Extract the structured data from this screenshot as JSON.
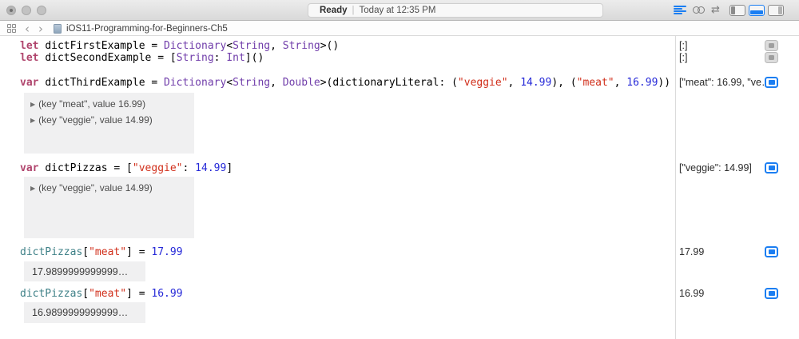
{
  "titlebar": {
    "status_ready": "Ready",
    "status_sep": "|",
    "status_time": "Today at 12:35 PM"
  },
  "jumpbar": {
    "file_name": "iOS11-Programming-for-Beginners-Ch5"
  },
  "colors": {
    "keyword": "#b0456d",
    "type": "#703daa",
    "string": "#d12f1b",
    "number": "#272ad8",
    "variable": "#3e8087",
    "accent": "#1b7ef2"
  },
  "editor": {
    "code_lines": [
      {
        "tokens": [
          [
            "kw",
            "let "
          ],
          [
            "pl",
            "dictFirstExample = "
          ],
          [
            "ty",
            "Dictionary"
          ],
          [
            "pl",
            "<"
          ],
          [
            "ty",
            "String"
          ],
          [
            "pl",
            ", "
          ],
          [
            "ty",
            "String"
          ],
          [
            "pl",
            ">()"
          ]
        ]
      },
      {
        "tokens": [
          [
            "kw",
            "let "
          ],
          [
            "pl",
            "dictSecondExample = ["
          ],
          [
            "ty",
            "String"
          ],
          [
            "pl",
            ": "
          ],
          [
            "ty",
            "Int"
          ],
          [
            "pl",
            "]()"
          ]
        ]
      },
      {
        "tokens": [
          [
            "kw",
            "var "
          ],
          [
            "pl",
            "dictThirdExample = "
          ],
          [
            "ty",
            "Dictionary"
          ],
          [
            "pl",
            "<"
          ],
          [
            "ty",
            "String"
          ],
          [
            "pl",
            ", "
          ],
          [
            "ty",
            "Double"
          ],
          [
            "pl",
            ">(dictionaryLiteral: ("
          ],
          [
            "st",
            "\"veggie\""
          ],
          [
            "pl",
            ", "
          ],
          [
            "nu",
            "14.99"
          ],
          [
            "pl",
            "), ("
          ],
          [
            "st",
            "\"meat\""
          ],
          [
            "pl",
            ", "
          ],
          [
            "nu",
            "16.99"
          ],
          [
            "pl",
            "))"
          ]
        ]
      },
      {
        "tokens": [
          [
            "kw",
            "var "
          ],
          [
            "pl",
            "dictPizzas = ["
          ],
          [
            "st",
            "\"veggie\""
          ],
          [
            "pl",
            ": "
          ],
          [
            "nu",
            "14.99"
          ],
          [
            "pl",
            "]"
          ]
        ]
      },
      {
        "tokens": [
          [
            "va",
            "dictPizzas"
          ],
          [
            "pl",
            "["
          ],
          [
            "st",
            "\"meat\""
          ],
          [
            "pl",
            "] = "
          ],
          [
            "nu",
            "17.99"
          ]
        ]
      },
      {
        "tokens": [
          [
            "va",
            "dictPizzas"
          ],
          [
            "pl",
            "["
          ],
          [
            "st",
            "\"meat\""
          ],
          [
            "pl",
            "] = "
          ],
          [
            "nu",
            "16.99"
          ]
        ]
      }
    ],
    "inline_results": [
      {
        "rows": [
          {
            "disclosure": true,
            "text": "(key \"meat\", value 16.99)"
          },
          {
            "disclosure": true,
            "text": "(key \"veggie\", value 14.99)"
          }
        ]
      },
      {
        "rows": [
          {
            "disclosure": true,
            "text": "(key \"veggie\", value 14.99)"
          }
        ]
      },
      {
        "rows": [
          {
            "disclosure": false,
            "text": "17.9899999999999…"
          }
        ]
      },
      {
        "rows": [
          {
            "disclosure": false,
            "text": "16.9899999999999…"
          }
        ]
      }
    ]
  },
  "sidebar": {
    "results": [
      {
        "text": "[:]",
        "button": "gray"
      },
      {
        "text": "[:]",
        "button": "gray"
      },
      {
        "text": "[\"meat\": 16.99, \"ve…",
        "button": "blue"
      },
      {
        "text": "[\"veggie\": 14.99]",
        "button": "blue"
      },
      {
        "text": "17.99",
        "button": "blue"
      },
      {
        "text": "16.99",
        "button": "blue"
      }
    ]
  }
}
